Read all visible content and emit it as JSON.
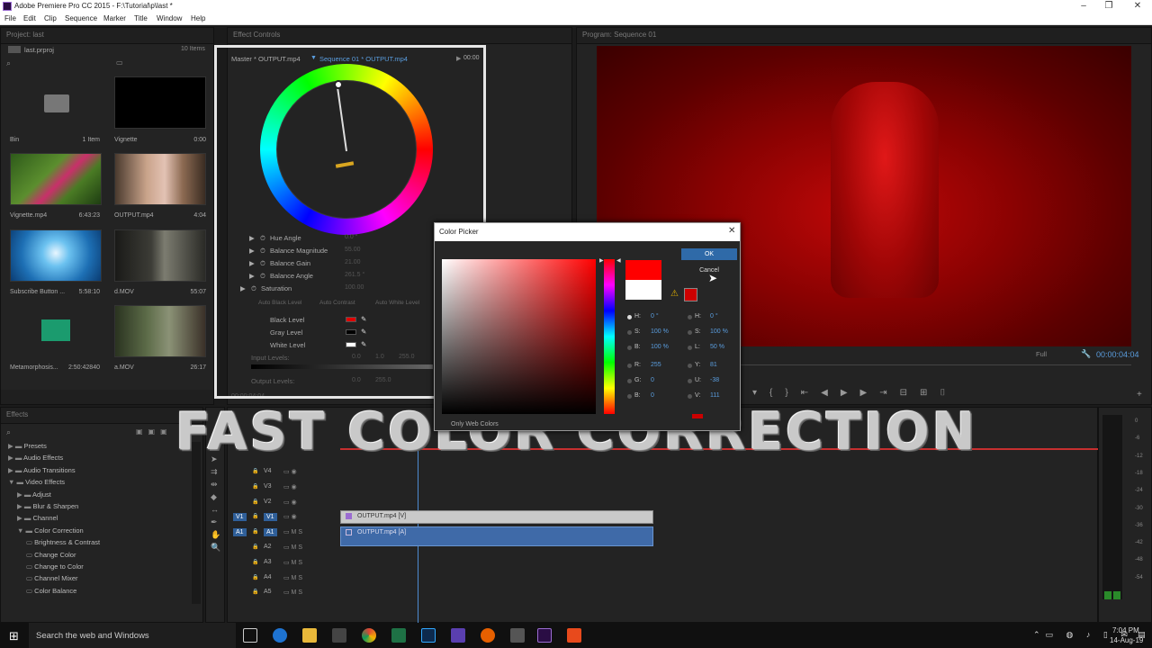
{
  "window": {
    "title": "Adobe Premiere Pro CC 2015 - F:\\Tutorial\\p\\last *"
  },
  "menu": [
    "File",
    "Edit",
    "Clip",
    "Sequence",
    "Marker",
    "Title",
    "Window",
    "Help"
  ],
  "project": {
    "tab": "Project: last",
    "file": "last.prproj",
    "item_count": "10 Items",
    "items": [
      {
        "name": "Bin",
        "meta": "1 Item"
      },
      {
        "name": "Vignette",
        "meta": "0:00"
      },
      {
        "name": "Vignette.mp4",
        "meta": "6:43:23"
      },
      {
        "name": "OUTPUT.mp4",
        "meta": "4:04"
      },
      {
        "name": "Subscribe Button ...",
        "meta": "5:58:10"
      },
      {
        "name": "d.MOV",
        "meta": "55:07"
      },
      {
        "name": "Metamorphosis...",
        "meta": "2:50:42840"
      },
      {
        "name": "a.MOV",
        "meta": "26:17"
      }
    ]
  },
  "effect_controls": {
    "tab": "Effect Controls",
    "master": "Master * OUTPUT.mp4",
    "sequence": "Sequence 01 * OUTPUT.mp4",
    "timecode": "00:00",
    "params": [
      "Hue Angle",
      "Balance Magnitude",
      "Balance Gain",
      "Balance Angle",
      "Saturation"
    ],
    "param_values": [
      "0.0 °",
      "55.00",
      "21.00",
      "261.5 °",
      "100.00"
    ],
    "buttons": [
      "Auto Black Level",
      "Auto Contrast",
      "Auto White Level"
    ],
    "levels": [
      {
        "label": "Black Level",
        "color": "#e00000"
      },
      {
        "label": "Gray Level",
        "color": "#000000"
      },
      {
        "label": "White Level",
        "color": "#ffffff"
      }
    ],
    "input_levels": {
      "label": "Input Levels:",
      "values": [
        "0.0",
        "1.0",
        "255.0"
      ]
    },
    "output_levels": {
      "label": "Output Levels:",
      "values": [
        "0.0",
        "255.0"
      ]
    },
    "footer_time": "00:00:04:04"
  },
  "program": {
    "tab": "Program: Sequence 01",
    "zoom": "Full",
    "timecode": "00:00:04:04"
  },
  "color_picker": {
    "title": "Color Picker",
    "ok": "OK",
    "cancel": "Cancel",
    "only_web": "Only Web Colors",
    "hex": "FF0000",
    "fields_left": [
      {
        "label": "H:",
        "value": "0 °"
      },
      {
        "label": "S:",
        "value": "100 %"
      },
      {
        "label": "B:",
        "value": "100 %"
      },
      {
        "label": "R:",
        "value": "255"
      },
      {
        "label": "G:",
        "value": "0"
      },
      {
        "label": "B:",
        "value": "0"
      }
    ],
    "fields_right": [
      {
        "label": "H:",
        "value": "0 °"
      },
      {
        "label": "S:",
        "value": "100 %"
      },
      {
        "label": "L:",
        "value": "50 %"
      },
      {
        "label": "Y:",
        "value": "81"
      },
      {
        "label": "U:",
        "value": "-38"
      },
      {
        "label": "V:",
        "value": "111"
      }
    ],
    "new_color": "#ff0000",
    "old_color": "#ffffff"
  },
  "effects": {
    "tab": "Effects",
    "tree": [
      {
        "label": "Presets",
        "level": 0
      },
      {
        "label": "Audio Effects",
        "level": 0
      },
      {
        "label": "Audio Transitions",
        "level": 0
      },
      {
        "label": "Video Effects",
        "level": 0
      },
      {
        "label": "Adjust",
        "level": 1
      },
      {
        "label": "Blur & Sharpen",
        "level": 1
      },
      {
        "label": "Channel",
        "level": 1
      },
      {
        "label": "Color Correction",
        "level": 1
      },
      {
        "label": "Brightness & Contrast",
        "level": 2
      },
      {
        "label": "Change Color",
        "level": 2
      },
      {
        "label": "Change to Color",
        "level": 2
      },
      {
        "label": "Channel Mixer",
        "level": 2
      },
      {
        "label": "Color Balance",
        "level": 2
      }
    ]
  },
  "timeline": {
    "tracks": [
      "V4",
      "V3",
      "V2",
      "V1",
      "A1",
      "A2",
      "A3",
      "A4",
      "A5"
    ],
    "video_clip": "OUTPUT.mp4 [V]",
    "audio_clip": "OUTPUT.mp4 [A]"
  },
  "meter": {
    "scale": [
      "0",
      "-6",
      "-12",
      "-18",
      "-24",
      "-30",
      "-36",
      "-42",
      "-48",
      "-54"
    ]
  },
  "overlay": {
    "headline": "FAST COLOR CORRECTION"
  },
  "taskbar": {
    "search": "Search the web and Windows",
    "time": "7:04 PM",
    "date": "14-Aug-19"
  }
}
